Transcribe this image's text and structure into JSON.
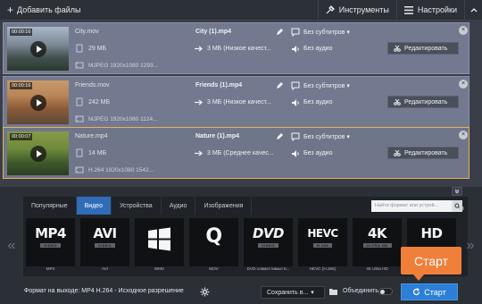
{
  "toolbar": {
    "add_files_label": "Добавить файлы",
    "tools_label": "Инструменты",
    "settings_label": "Настройки"
  },
  "files": [
    {
      "thumb_time": "00:00:16",
      "name": "City.mov",
      "size": "29 МБ",
      "meta": "MJPEG 1920x1080 1293...",
      "out_name": "City (1).mp4",
      "out_size": "3 МБ (Низкое качест...",
      "subtitles": "Без субтитров",
      "audio": "Без аудио",
      "edit_label": "Редактировать"
    },
    {
      "thumb_time": "00:00:16",
      "name": "Friends.mov",
      "size": "242 МБ",
      "meta": "MJPEG 1920x1080 1124...",
      "out_name": "Friends (1).mp4",
      "out_size": "3 МБ (Низкое качест...",
      "subtitles": "Без субтитров",
      "audio": "Без аудио",
      "edit_label": "Редактировать"
    },
    {
      "thumb_time": "00:00:07",
      "name": "Nature.mp4",
      "size": "14 МБ",
      "meta": "H.264 1920x1080 1542...",
      "out_name": "Nature (1).mp4",
      "out_size": "3 МБ (Среднее качес...",
      "subtitles": "Без субтитров",
      "audio": "Без аудио",
      "edit_label": "Редактировать"
    }
  ],
  "format_tabs": [
    "Популярные",
    "Видео",
    "Устройства",
    "Аудио",
    "Изображения"
  ],
  "active_tab": "Видео",
  "format_search_placeholder": "Найти формат или устрой...",
  "formats": [
    {
      "logo": "MP4",
      "sub": "VIDEO",
      "label": "MP4"
    },
    {
      "logo": "AVI",
      "sub": "VIDEO",
      "label": "AVI"
    },
    {
      "logo": "",
      "sub": "",
      "label": "WMV"
    },
    {
      "logo": "Q",
      "sub": "",
      "label": "MOV"
    },
    {
      "logo": "DVD",
      "sub": "VIDEO",
      "label": "DVD-совместимые в..."
    },
    {
      "logo": "HEVC",
      "sub": "H.265",
      "label": "HEVC (H.265)"
    },
    {
      "logo": "4K",
      "sub": "ULTRA HD",
      "label": "4K Ultra HD"
    },
    {
      "logo": "HD",
      "sub": "",
      "label": "HD"
    }
  ],
  "bottom": {
    "output_format": "Формат на выходе: MP4 H.264 - Исходное разрешение",
    "save_to": "Сохранить в...",
    "merge_label": "Объединить",
    "start_label": "Старт"
  },
  "callout_label": "Старт",
  "colors": {
    "accent_blue": "#2b7fd6",
    "callout_orange": "#f07f3a",
    "selected_border": "#e2b25a"
  }
}
